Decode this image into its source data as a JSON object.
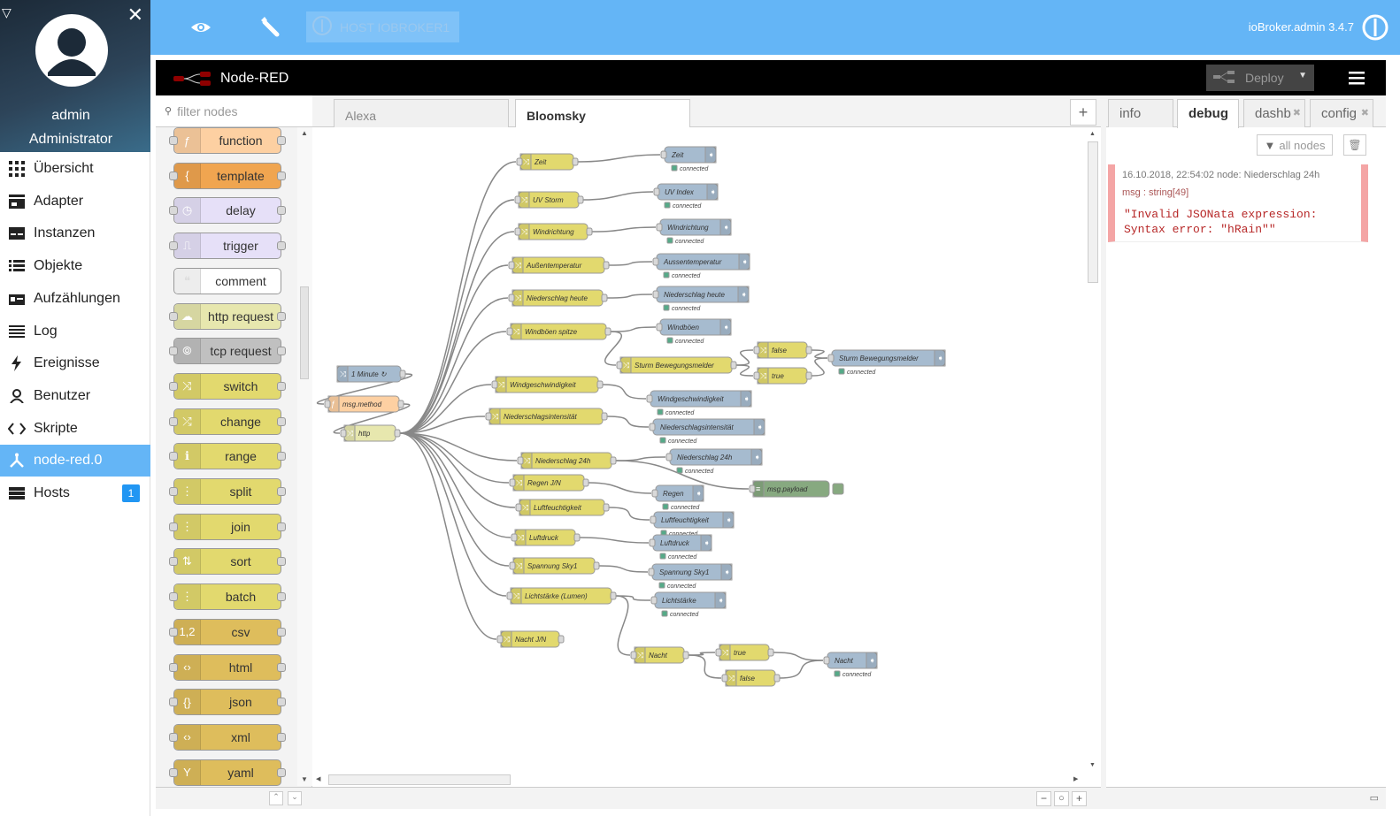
{
  "sidebar": {
    "user": {
      "name": "admin",
      "role": "Administrator"
    },
    "items": [
      {
        "label": "Übersicht",
        "icon": "apps-icon"
      },
      {
        "label": "Adapter",
        "icon": "store-icon"
      },
      {
        "label": "Instanzen",
        "icon": "instances-icon"
      },
      {
        "label": "Objekte",
        "icon": "list-icon"
      },
      {
        "label": "Aufzählungen",
        "icon": "enum-icon"
      },
      {
        "label": "Log",
        "icon": "log-icon"
      },
      {
        "label": "Ereignisse",
        "icon": "flash-icon"
      },
      {
        "label": "Benutzer",
        "icon": "user-icon"
      },
      {
        "label": "Skripte",
        "icon": "code-icon"
      },
      {
        "label": "node-red.0",
        "icon": "node-red-icon",
        "active": true
      },
      {
        "label": "Hosts",
        "icon": "hosts-icon",
        "badge": "1"
      }
    ]
  },
  "topbar": {
    "host": "HOST IOBROKER1",
    "version": "ioBroker.admin 3.4.7"
  },
  "nodered": {
    "title": "Node-RED",
    "deploy": "Deploy",
    "filter_placeholder": "filter nodes",
    "palette": [
      {
        "label": "function",
        "color": "#fdd0a2",
        "glyph": "ƒ"
      },
      {
        "label": "template",
        "color": "#f0a550",
        "glyph": "{"
      },
      {
        "label": "delay",
        "color": "#e6e0f8",
        "glyph": "◷"
      },
      {
        "label": "trigger",
        "color": "#e6e0f8",
        "glyph": "⎍"
      },
      {
        "label": "comment",
        "color": "#ffffff",
        "glyph": "❝"
      },
      {
        "label": "http request",
        "color": "#e7e7ae",
        "glyph": "☁"
      },
      {
        "label": "tcp request",
        "color": "#c0c0c0",
        "glyph": "⦾"
      },
      {
        "label": "switch",
        "color": "#e2d96e",
        "glyph": "⤨"
      },
      {
        "label": "change",
        "color": "#e2d96e",
        "glyph": "⤮"
      },
      {
        "label": "range",
        "color": "#e2d96e",
        "glyph": "ℹ"
      },
      {
        "label": "split",
        "color": "#e2d96e",
        "glyph": "⋮"
      },
      {
        "label": "join",
        "color": "#e2d96e",
        "glyph": "⋮"
      },
      {
        "label": "sort",
        "color": "#e2d96e",
        "glyph": "⇅"
      },
      {
        "label": "batch",
        "color": "#e2d96e",
        "glyph": "⋮"
      },
      {
        "label": "csv",
        "color": "#debd5c",
        "glyph": "1,2"
      },
      {
        "label": "html",
        "color": "#debd5c",
        "glyph": "‹›"
      },
      {
        "label": "json",
        "color": "#debd5c",
        "glyph": "{}"
      },
      {
        "label": "xml",
        "color": "#debd5c",
        "glyph": "‹›"
      },
      {
        "label": "yaml",
        "color": "#debd5c",
        "glyph": "Y"
      }
    ],
    "tabs": [
      "Alexa",
      "Bloomsky"
    ],
    "active_tab": "Bloomsky",
    "sidebar_tabs": [
      "info",
      "debug",
      "dashb",
      "config"
    ],
    "all_nodes": "all nodes",
    "debug": {
      "meta": "16.10.2018, 22:54:02   node: Niederschlag 24h",
      "type": "msg : string[49]",
      "body": "\"Invalid JSONata expression:\nSyntax error: \"hRain\"\""
    },
    "connected": "connected",
    "colors": {
      "change": "#e2d96e",
      "output": "#a6bbcf",
      "function": "#fdd0a2",
      "debug": "#87a980",
      "inject": "#a6bbcf"
    }
  }
}
